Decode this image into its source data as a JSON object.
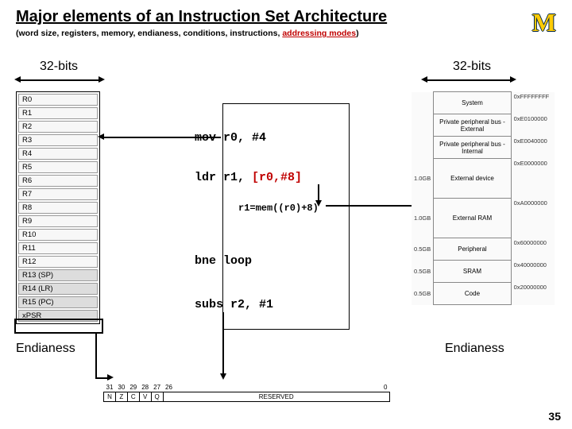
{
  "title": "Major elements of an Instruction Set Architecture",
  "subtitle_parts": {
    "prefix": "(word size, registers, memory, endianess, conditions, instructions, ",
    "emph": "addressing modes",
    "suffix": ")"
  },
  "logo": "M",
  "labels": {
    "bits_left": "32-bits",
    "bits_right": "32-bits",
    "endianess_left": "Endianess",
    "endianess_right": "Endianess"
  },
  "registers": [
    "R0",
    "R1",
    "R2",
    "R3",
    "R4",
    "R5",
    "R6",
    "R7",
    "R8",
    "R9",
    "R10",
    "R11",
    "R12",
    "R13 (SP)",
    "R14 (LR)",
    "R15 (PC)",
    "xPSR"
  ],
  "shaded_regs": [
    13,
    14,
    15,
    16
  ],
  "code": {
    "l1": "mov r0, #4",
    "l2_a": "ldr r1, ",
    "l2_b": "[r0,#8]",
    "expl": "r1=mem((r0)+8)",
    "l3": "bne loop",
    "l4": "subs r2, #1"
  },
  "memory_map": [
    {
      "addr": "0xFFFFFFFF",
      "region": "System",
      "size": ""
    },
    {
      "addr": "0xE0100000",
      "region": "Private peripheral bus - External",
      "size": ""
    },
    {
      "addr": "0xE0040000",
      "region": "Private peripheral bus - Internal",
      "size": ""
    },
    {
      "addr": "0xE0000000",
      "region": "External device",
      "size": "1.0GB"
    },
    {
      "addr": "0xA0000000",
      "region": "External RAM",
      "size": "1.0GB"
    },
    {
      "addr": "0x60000000",
      "region": "Peripheral",
      "size": "0.5GB"
    },
    {
      "addr": "0x40000000",
      "region": "SRAM",
      "size": "0.5GB"
    },
    {
      "addr": "0x20000000",
      "region": "Code",
      "size": "0.5GB"
    }
  ],
  "psr": {
    "bits": [
      "31",
      "30",
      "29",
      "28",
      "27",
      "26",
      "",
      "0"
    ],
    "flags": [
      "N",
      "Z",
      "C",
      "V",
      "Q"
    ],
    "reserved": "RESERVED"
  },
  "slide_number": "35"
}
